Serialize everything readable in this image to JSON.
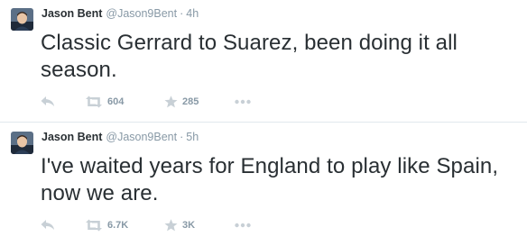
{
  "colors": {
    "name": "#292f33",
    "muted": "#8899a6",
    "icon": "#c8d0d6",
    "divider": "#e1e8ed"
  },
  "tweets": [
    {
      "name": "Jason Bent",
      "handle": "@Jason9Bent",
      "separator": "·",
      "time": "4h",
      "text": "Classic Gerrard to Suarez, been doing it all season.",
      "retweets": "604",
      "favorites": "285",
      "icons": [
        "reply-icon",
        "retweet-icon",
        "star-icon",
        "more-icon"
      ]
    },
    {
      "name": "Jason Bent",
      "handle": "@Jason9Bent",
      "separator": "·",
      "time": "5h",
      "text": "I've waited years for England to play like Spain, now we are.",
      "retweets": "6.7K",
      "favorites": "3K",
      "icons": [
        "reply-icon",
        "retweet-icon",
        "star-icon",
        "more-icon"
      ]
    }
  ]
}
